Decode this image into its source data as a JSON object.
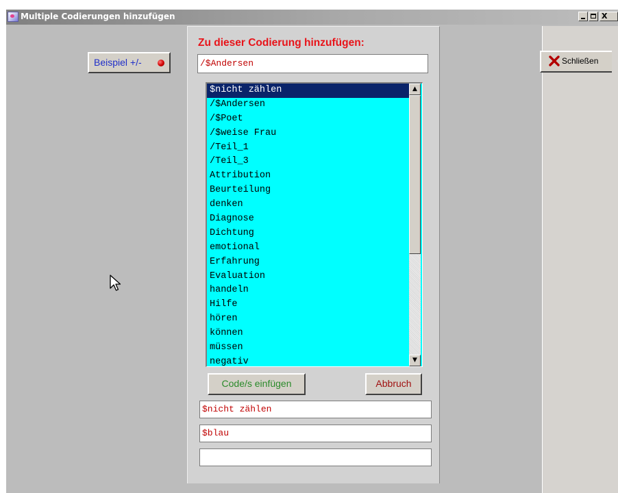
{
  "window": {
    "title": "Multiple Codierungen hinzufügen",
    "controls": {
      "minimize": "_",
      "maximize": "□",
      "close": "X"
    }
  },
  "left": {
    "sample_button_label": "Beispiel +/-"
  },
  "center": {
    "heading": "Zu dieser Codierung hinzufügen:",
    "target_code_value": "/$Andersen",
    "code_list": {
      "selected": "$nicht zählen",
      "items": [
        "$nicht zählen",
        "/$Andersen",
        "/$Poet",
        "/$weise Frau",
        "/Teil_1",
        "/Teil_3",
        "Attribution",
        "Beurteilung",
        "denken",
        "Diagnose",
        "Dichtung",
        "emotional",
        "Erfahrung",
        "Evaluation",
        "handeln",
        "Hilfe",
        "hören",
        "können",
        "müssen",
        "negativ"
      ]
    },
    "insert_button_label": "Code/s einfügen",
    "cancel_button_label": "Abbruch",
    "selected_codes": [
      "$nicht zählen",
      "$blau",
      ""
    ]
  },
  "right": {
    "close_button_label": "Schließen"
  },
  "colors": {
    "window_bg": "#bcbcbc",
    "panel_bg": "#d2d2d2",
    "list_bg": "#00ffff",
    "selection_bg": "#0a246a",
    "heading_red": "#e8141a",
    "code_text_red": "#c00000",
    "insert_green": "#2a8a2a",
    "cancel_red": "#a01010",
    "sample_blue": "#1f2ec9"
  },
  "icons": [
    "app-icon",
    "red-dot-icon",
    "close-x-icon",
    "scroll-up-arrow-icon",
    "scroll-down-arrow-icon",
    "mouse-pointer-icon"
  ]
}
